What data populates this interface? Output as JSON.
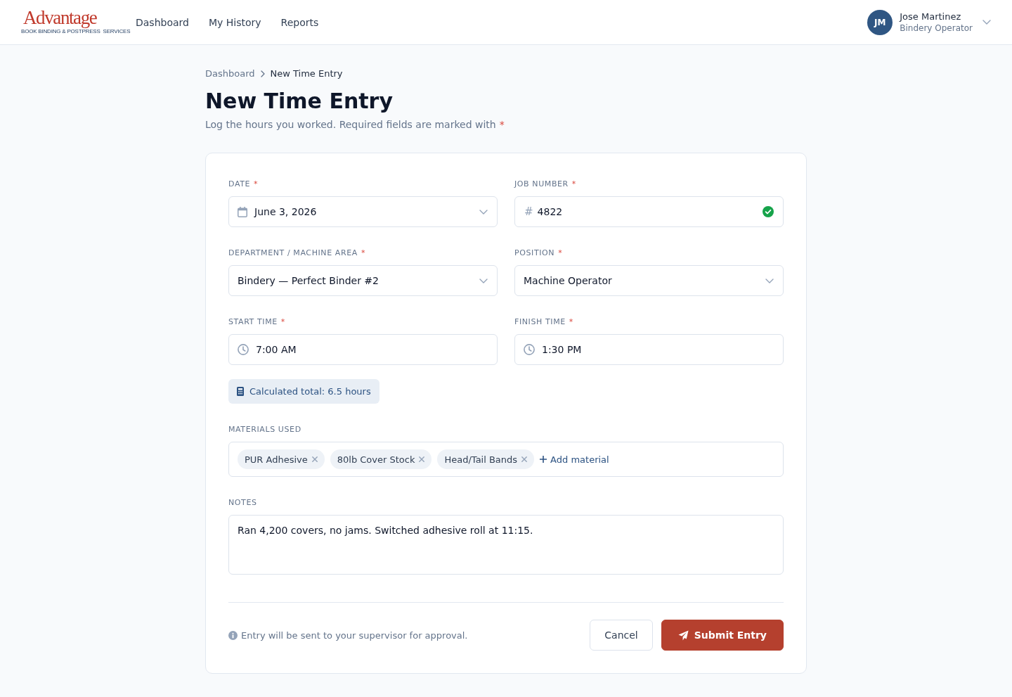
{
  "header": {
    "logo": {
      "wordmark": "Advantage",
      "tagline": "BOOK BINDING & POSTPRESS",
      "tagline_end": "SERVICES"
    },
    "nav": [
      "Dashboard",
      "My History",
      "Reports"
    ],
    "user": {
      "initials": "JM",
      "name": "Jose Martinez",
      "role": "Bindery Operator"
    }
  },
  "breadcrumb": [
    "Dashboard",
    "New Time Entry"
  ],
  "title": "New Time Entry",
  "subtitle": {
    "text": "Log the hours you worked. Required fields are marked with",
    "required_mark": "*"
  },
  "fields": [
    {
      "kind": "date",
      "label": "DATE",
      "required_mark": "*",
      "value": "June 3, 2026"
    },
    {
      "kind": "number",
      "label": "JOB NUMBER",
      "required_mark": "*",
      "prefix": "#",
      "value": "4822",
      "valid": true
    },
    {
      "kind": "select",
      "label": "DEPARTMENT / MACHINE AREA",
      "required_mark": "*",
      "value": "Bindery — Perfect Binder #2"
    },
    {
      "kind": "select",
      "label": "POSITION",
      "required_mark": "*",
      "value": "Machine Operator"
    },
    {
      "kind": "time",
      "label": "START TIME",
      "required_mark": "*",
      "value": "7:00 AM"
    },
    {
      "kind": "time",
      "label": "FINISH TIME",
      "required_mark": "*",
      "value": "1:30 PM"
    }
  ],
  "total": "Calculated total: 6.5 hours",
  "materials": {
    "label": "MATERIALS USED",
    "tags": [
      "PUR Adhesive",
      "80lb Cover Stock",
      "Head/Tail Bands"
    ],
    "add_label": "Add material"
  },
  "notes": {
    "label": "NOTES",
    "value": "Ran 4,200 covers, no jams. Switched adhesive roll at 11:15."
  },
  "footer": {
    "note": "Entry will be sent to your supervisor for approval.",
    "buttons": [
      {
        "kind": "secondary",
        "label": "Cancel"
      },
      {
        "kind": "primary",
        "label": "Submit Entry"
      }
    ]
  }
}
